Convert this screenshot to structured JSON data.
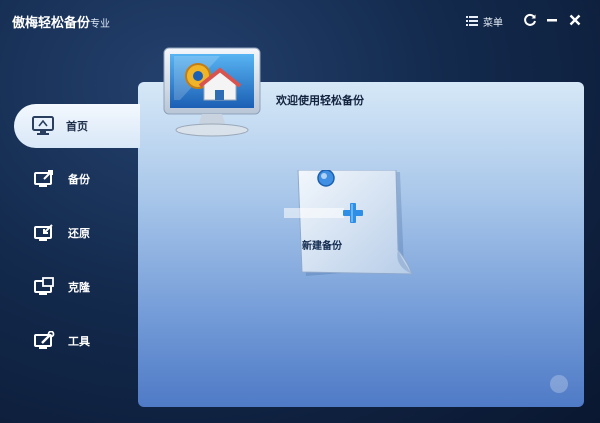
{
  "header": {
    "title": "傲梅轻松备份",
    "edition": "专业",
    "menu_label": "菜单"
  },
  "window_controls": {
    "refresh_icon": "refresh-icon",
    "minimize_icon": "minimize-icon",
    "close_icon": "close-icon"
  },
  "sidebar": {
    "items": [
      {
        "label": "首页",
        "icon": "home-monitor-icon",
        "active": true
      },
      {
        "label": "备份",
        "icon": "backup-icon",
        "active": false
      },
      {
        "label": "还原",
        "icon": "restore-icon",
        "active": false
      },
      {
        "label": "克隆",
        "icon": "clone-icon",
        "active": false
      },
      {
        "label": "工具",
        "icon": "tools-icon",
        "active": false
      }
    ]
  },
  "main": {
    "welcome_text": "欢迎使用轻松备份",
    "new_backup_label": "新建备份"
  },
  "colors": {
    "accent": "#3a8fe0",
    "panel_top": "#d6e8f7",
    "panel_bottom": "#4f7ac6",
    "background": "#132a4d"
  }
}
